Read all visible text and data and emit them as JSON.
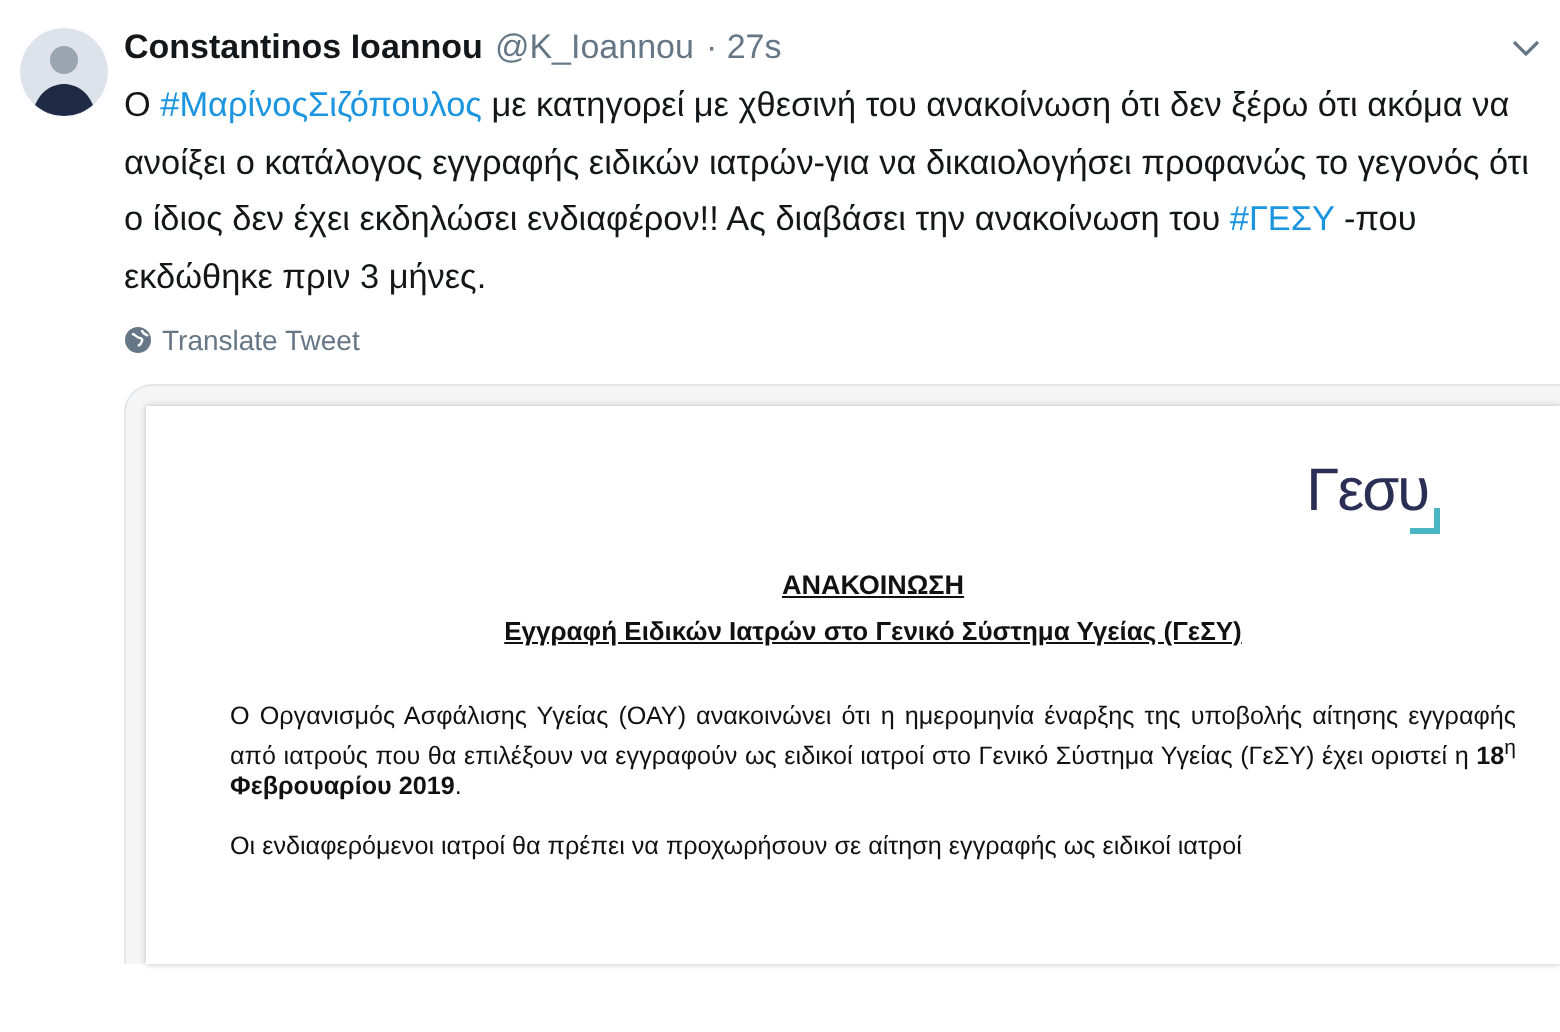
{
  "tweet": {
    "author_name": "Constantinos Ioannou",
    "handle": "@K_Ioannou",
    "time": "· 27s",
    "text": [
      {
        "kind": "plain",
        "text": "Ο "
      },
      {
        "kind": "hashtag",
        "text": "#ΜαρίνοςΣιζόπουλος"
      },
      {
        "kind": "plain",
        "text": " με κατηγορεί με χθεσινή του ανακοίνωση ότι δεν ξέρω ότι ακόμα να ανοίξει ο κατάλογος εγγραφής ειδικών ιατρών-για να δικαιολογήσει προφανώς το γεγονός ότι ο ίδιος δεν έχει εκδηλώσει ενδιαφέρον!! Ας διαβάσει την ανακοίνωση του "
      },
      {
        "kind": "hashtag",
        "text": "#ΓΕΣΥ"
      },
      {
        "kind": "plain",
        "text": " -που εκδώθηκε πριν 3 μήνες."
      }
    ],
    "translate_label": "Translate Tweet",
    "document": {
      "logo": "Γεσυ",
      "heading": "ΑΝΑΚΟΙΝΩΣΗ",
      "subheading": "Εγγραφή Ειδικών Ιατρών στο Γενικό Σύστημα Υγείας (ΓεΣΥ)",
      "paragraphs": [
        "Ο Οργανισμός Ασφάλισης Υγείας (ΟΑΥ) ανακοινώνει ότι η ημερομηνία έναρξης της υποβολής αίτησης εγγραφής από ιατρούς που θα επιλέξουν να εγγραφούν ως ειδικοί ιατροί στο Γενικό Σύστημα Υγείας (ΓεΣΥ) έχει οριστεί η **18**$^{η}$ **Φεβρουαρίου 2019**.",
        "Οι ενδιαφερόμενοι ιατροί θα πρέπει να προχωρήσουν σε αίτηση εγγραφής ως ειδικοί ιατροί"
      ]
    }
  }
}
